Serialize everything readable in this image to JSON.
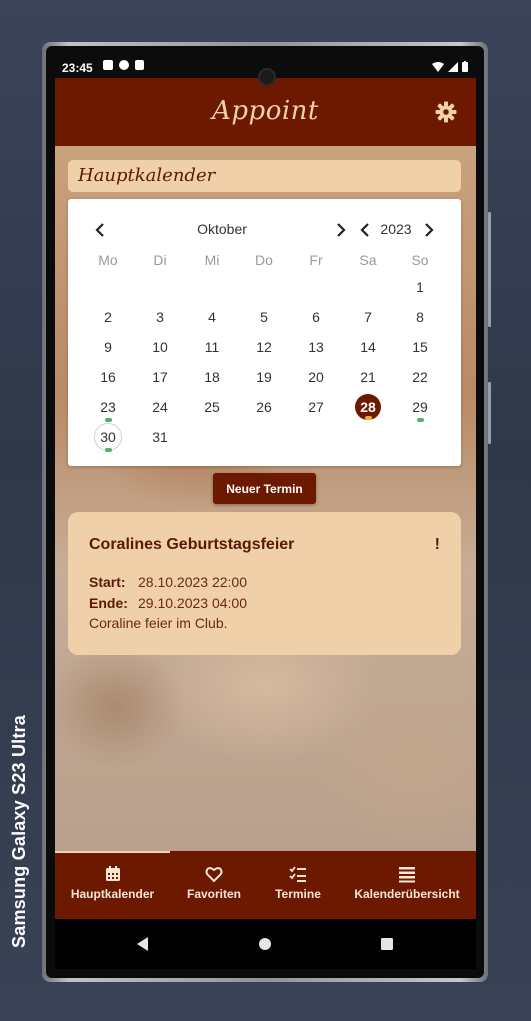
{
  "device": {
    "label": "Samsung Galaxy  S23 Ultra"
  },
  "status_bar": {
    "time": "23:45"
  },
  "app": {
    "title": "Appoint",
    "settings_icon": "gear-icon"
  },
  "section": {
    "title": "Hauptkalender"
  },
  "calendar": {
    "month": "Oktober",
    "year": "2023",
    "weekdays": [
      "Mo",
      "Di",
      "Mi",
      "Do",
      "Fr",
      "Sa",
      "So"
    ],
    "days": [
      "1",
      "2",
      "3",
      "4",
      "5",
      "6",
      "7",
      "8",
      "9",
      "10",
      "11",
      "12",
      "13",
      "14",
      "15",
      "16",
      "17",
      "18",
      "19",
      "20",
      "21",
      "22",
      "23",
      "24",
      "25",
      "26",
      "27",
      "28",
      "29",
      "30",
      "31"
    ],
    "selected_day": "28",
    "today": "30",
    "days_with_events": [
      "23",
      "28",
      "29",
      "30"
    ]
  },
  "new_appointment_button": "Neuer Termin",
  "event": {
    "title": "Coralines Geburtstagsfeier",
    "flag": "!",
    "start_label": "Start:",
    "start_value": "28.10.2023 22:00",
    "end_label": "Ende:",
    "end_value": "29.10.2023 04:00",
    "description": "Coraline feier im Club."
  },
  "bottom_nav": {
    "items": [
      {
        "label": "Hauptkalender",
        "icon": "calendar-icon",
        "active": true
      },
      {
        "label": "Favoriten",
        "icon": "heart-icon",
        "active": false
      },
      {
        "label": "Termine",
        "icon": "checklist-icon",
        "active": false
      },
      {
        "label": "Kalenderübersicht",
        "icon": "list-icon",
        "active": false
      }
    ]
  },
  "colors": {
    "primary": "#6d1900",
    "accent": "#efd0a8",
    "event_dot": "#4fb46a",
    "selected_dot": "#f2a73b"
  }
}
